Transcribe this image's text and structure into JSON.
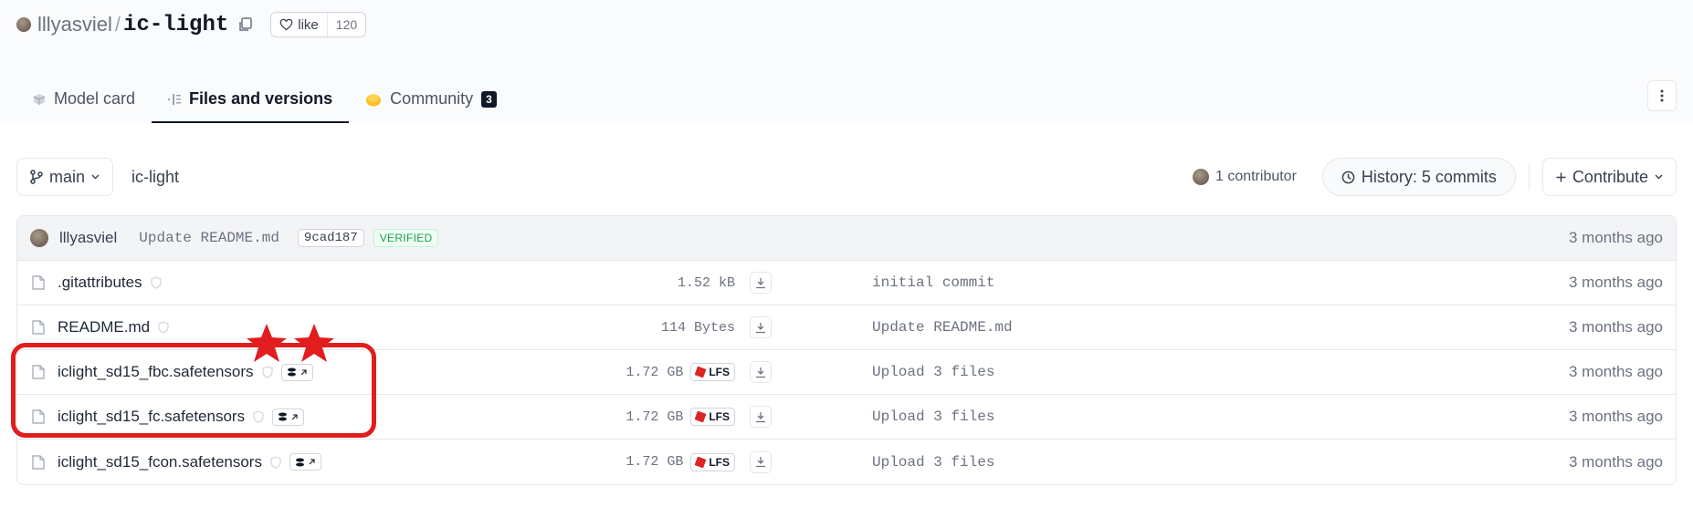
{
  "header": {
    "owner": "lllyasviel",
    "separator": "/",
    "repo_name": "ic-light",
    "like_label": "like",
    "like_count": "120"
  },
  "tabs": [
    {
      "label": "Model card",
      "icon": "cube-icon"
    },
    {
      "label": "Files and versions",
      "icon": "files-icon",
      "active": true
    },
    {
      "label": "Community",
      "icon": "community-icon",
      "badge": "3"
    }
  ],
  "toolbar": {
    "branch": "main",
    "path": "ic-light",
    "contributors": "1 contributor",
    "history": "History: 5 commits",
    "contribute": "Contribute"
  },
  "last_commit": {
    "author": "lllyasviel",
    "message": "Update README.md",
    "hash": "9cad187",
    "verified_label": "VERIFIED",
    "time": "3 months ago"
  },
  "files": [
    {
      "name": ".gitattributes",
      "size": "1.52 kB",
      "lfs": false,
      "safetensors": false,
      "commit": "initial commit",
      "time": "3 months ago"
    },
    {
      "name": "README.md",
      "size": "114 Bytes",
      "lfs": false,
      "safetensors": false,
      "commit": "Update README.md",
      "time": "3 months ago"
    },
    {
      "name": "iclight_sd15_fbc.safetensors",
      "size": "1.72 GB",
      "lfs": true,
      "safetensors": true,
      "commit": "Upload 3 files",
      "time": "3 months ago"
    },
    {
      "name": "iclight_sd15_fc.safetensors",
      "size": "1.72 GB",
      "lfs": true,
      "safetensors": true,
      "commit": "Upload 3 files",
      "time": "3 months ago"
    },
    {
      "name": "iclight_sd15_fcon.safetensors",
      "size": "1.72 GB",
      "lfs": true,
      "safetensors": true,
      "commit": "Upload 3 files",
      "time": "3 months ago"
    }
  ],
  "labels": {
    "lfs": "LFS"
  },
  "colors": {
    "annotation_red": "#e11d1d",
    "verified_green": "#16a34a",
    "lfs_red": "#dc2626"
  }
}
